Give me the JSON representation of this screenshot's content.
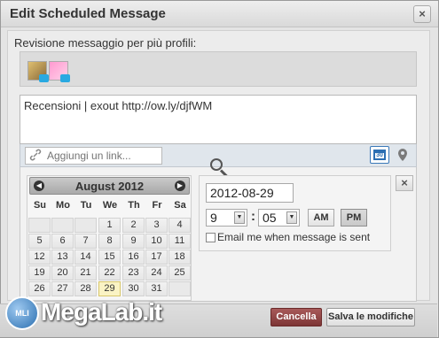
{
  "dialog": {
    "title": "Edit Scheduled Message",
    "close_label": "×"
  },
  "profiles": {
    "label": "Revisione messaggio per più profili:"
  },
  "message": {
    "text": "Recensioni  | exout http://ow.ly/djfWM"
  },
  "link": {
    "placeholder": "Aggiungi un link..."
  },
  "calendar_button": {
    "label": "30"
  },
  "calendar": {
    "month": "August 2012",
    "prev": "◀",
    "next": "▶",
    "days_of_week": [
      "Su",
      "Mo",
      "Tu",
      "We",
      "Th",
      "Fr",
      "Sa"
    ],
    "weeks": [
      [
        "",
        "",
        "",
        "1",
        "2",
        "3",
        "4"
      ],
      [
        "5",
        "6",
        "7",
        "8",
        "9",
        "10",
        "11"
      ],
      [
        "12",
        "13",
        "14",
        "15",
        "16",
        "17",
        "18"
      ],
      [
        "19",
        "20",
        "21",
        "22",
        "23",
        "24",
        "25"
      ],
      [
        "26",
        "27",
        "28",
        "29",
        "30",
        "31",
        ""
      ]
    ],
    "selected_day": "29"
  },
  "schedule": {
    "date": "2012-08-29",
    "hour": "9",
    "minute": "05",
    "colon": ":",
    "am_label": "AM",
    "pm_label": "PM",
    "selected_period": "PM",
    "email_label": "Email me when message is sent",
    "email_checked": false,
    "close_label": "×"
  },
  "footer": {
    "cancel_label": "Cancella",
    "save_label": "Salva le modifiche"
  },
  "watermark": {
    "text": "MegaLab.it",
    "badge": "MLI"
  }
}
